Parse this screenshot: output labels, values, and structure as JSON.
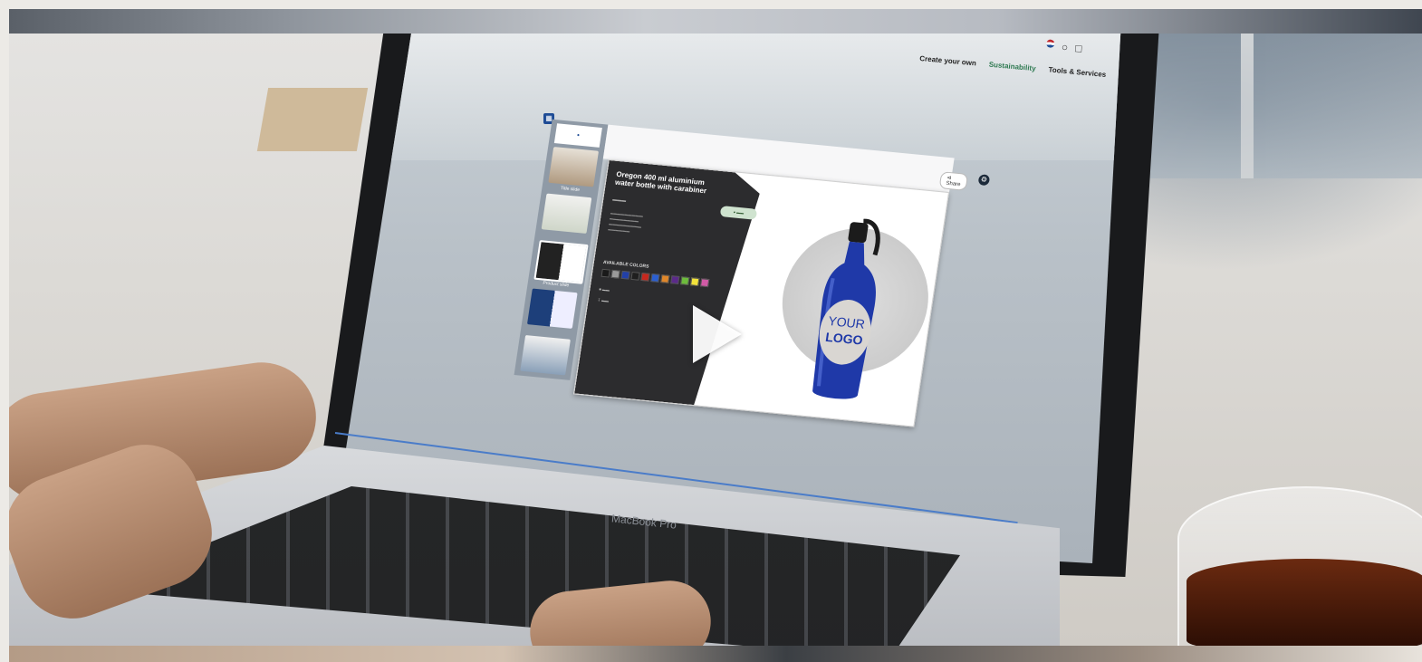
{
  "site": {
    "nav": [
      "Create your own",
      "Sustainability",
      "Tools & Services"
    ],
    "active_nav": "Sustainability",
    "icons": [
      "flag-icon",
      "user-icon",
      "cart-icon"
    ]
  },
  "viewer": {
    "share_label": "Share",
    "thumbnail_labels": [
      "Title slide",
      "",
      "Product slide",
      "",
      ""
    ],
    "product": {
      "title": "Oregon 400 ml aluminium water bottle with carabiner",
      "colors_label": "AVAILABLE COLORS",
      "colors": [
        "#1a1a1a",
        "#9a9a9a",
        "#2240a8",
        "#1f1f1f",
        "#c8281e",
        "#2b5fd1",
        "#e0872a",
        "#5b2a8a",
        "#6dbb3c",
        "#f2e23a",
        "#d25aa6"
      ],
      "logo_text": [
        "YOUR",
        "LOGO"
      ]
    }
  },
  "video": {
    "play_icon": "play-icon"
  },
  "device": {
    "brand": "MacBook Pro"
  },
  "colors": {
    "accent_blue": "#1d4b95",
    "sustainability_green": "#2f7a52",
    "bottle_blue": "#1f39a8"
  }
}
